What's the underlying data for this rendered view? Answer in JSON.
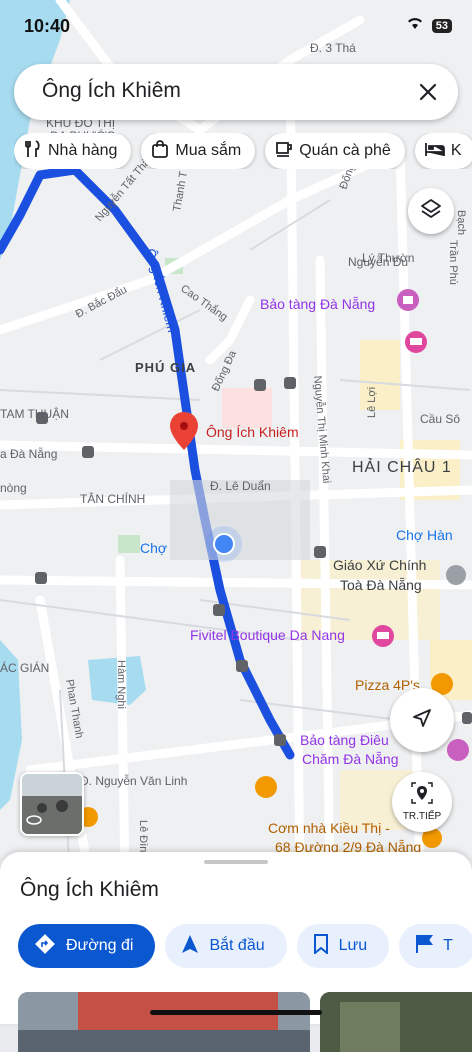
{
  "status": {
    "time": "10:40",
    "battery": "53"
  },
  "search": {
    "query": "Ông Ích Khiêm"
  },
  "chips": [
    {
      "label": "Nhà hàng",
      "icon": "fork-knife-icon"
    },
    {
      "label": "Mua sắm",
      "icon": "shopping-bag-icon"
    },
    {
      "label": "Quán cà phê",
      "icon": "coffee-cup-icon"
    },
    {
      "label": "K",
      "icon": "bed-icon"
    }
  ],
  "map": {
    "labels": {
      "phu_gia": "PHÚ GIA",
      "hai_chau": "HẢI CHÂU 1",
      "tam_thuan": "TAM THUẬN",
      "tan_chinh": "TÂN CHÍNH",
      "ac_gian": "ÁC GIÁN",
      "da_nang_left": "a Đà Nẵng",
      "khu_do_thi": "KHU ĐÔ THỊ",
      "da_phuoc": "ĐA PHƯỚC",
      "ong_ich_khiem_road": "Ông Ích Khiêm",
      "nguyen_tat_thanh": "Nguyễn Tất Thành",
      "thanh_t": "Thanh T",
      "cao_thang": "Cao Thắng",
      "dong_da": "Đống Đa",
      "dong": "Đống",
      "bac_dau": "Đ. Bắc Đẩu",
      "ly_thuong": "Lý Thườn",
      "nguyen_du": "Nguyễn Du",
      "nguyen_thi_minh_khai": "Nguyễn Thị Minh Khai",
      "le_loi": "Lê Lợi",
      "le_duan": "Đ. Lê Duẩn",
      "nguyen_van_linh": "Đ. Nguyễn Văn Linh",
      "phan_thanh": "Phan Thanh",
      "ham_nghi": "Hàm Nghi",
      "le_dinh": "Lê Đình",
      "tran_phu": "Trần Phú",
      "bach": "Bạch",
      "d3thang": "Đ. 3 Thá",
      "cau_so": "Cầu Sô",
      "nong": "nòng",
      "cho_partial": "Chợ",
      "poi_museum": "Bảo tàng Đà Nẵng",
      "poi_pin": "Ông Ích Khiêm",
      "poi_cho_han": "Chợ Hàn",
      "poi_church_1": "Giáo Xứ Chính",
      "poi_church_2": "Toà Đà Nẵng",
      "poi_fivitel": "Fivitel Boutique Da Nang",
      "poi_pizza": "Pizza 4P's",
      "poi_dieu_1": "Bảo tàng Điêu",
      "poi_dieu_2": "Chăm Đà Nẵng",
      "poi_com_1": "Cơm nhà Kiều Thị -",
      "poi_com_2": "68 Đường 2/9 Đà Nẵng"
    }
  },
  "buttons": {
    "next_label": "TR.TIẾP"
  },
  "sheet": {
    "title": "Ông Ích Khiêm",
    "actions": [
      {
        "label": "Đường đi",
        "icon": "directions-icon"
      },
      {
        "label": "Bắt đầu",
        "icon": "navigation-arrow-icon"
      },
      {
        "label": "Lưu",
        "icon": "bookmark-icon"
      },
      {
        "label": "T",
        "icon": "flag-icon"
      }
    ]
  },
  "colors": {
    "accent": "#0b57d0",
    "route": "#1a4fe0",
    "pin": "#ea4335",
    "water": "#a7dcf0",
    "park": "#c8e6c9"
  }
}
